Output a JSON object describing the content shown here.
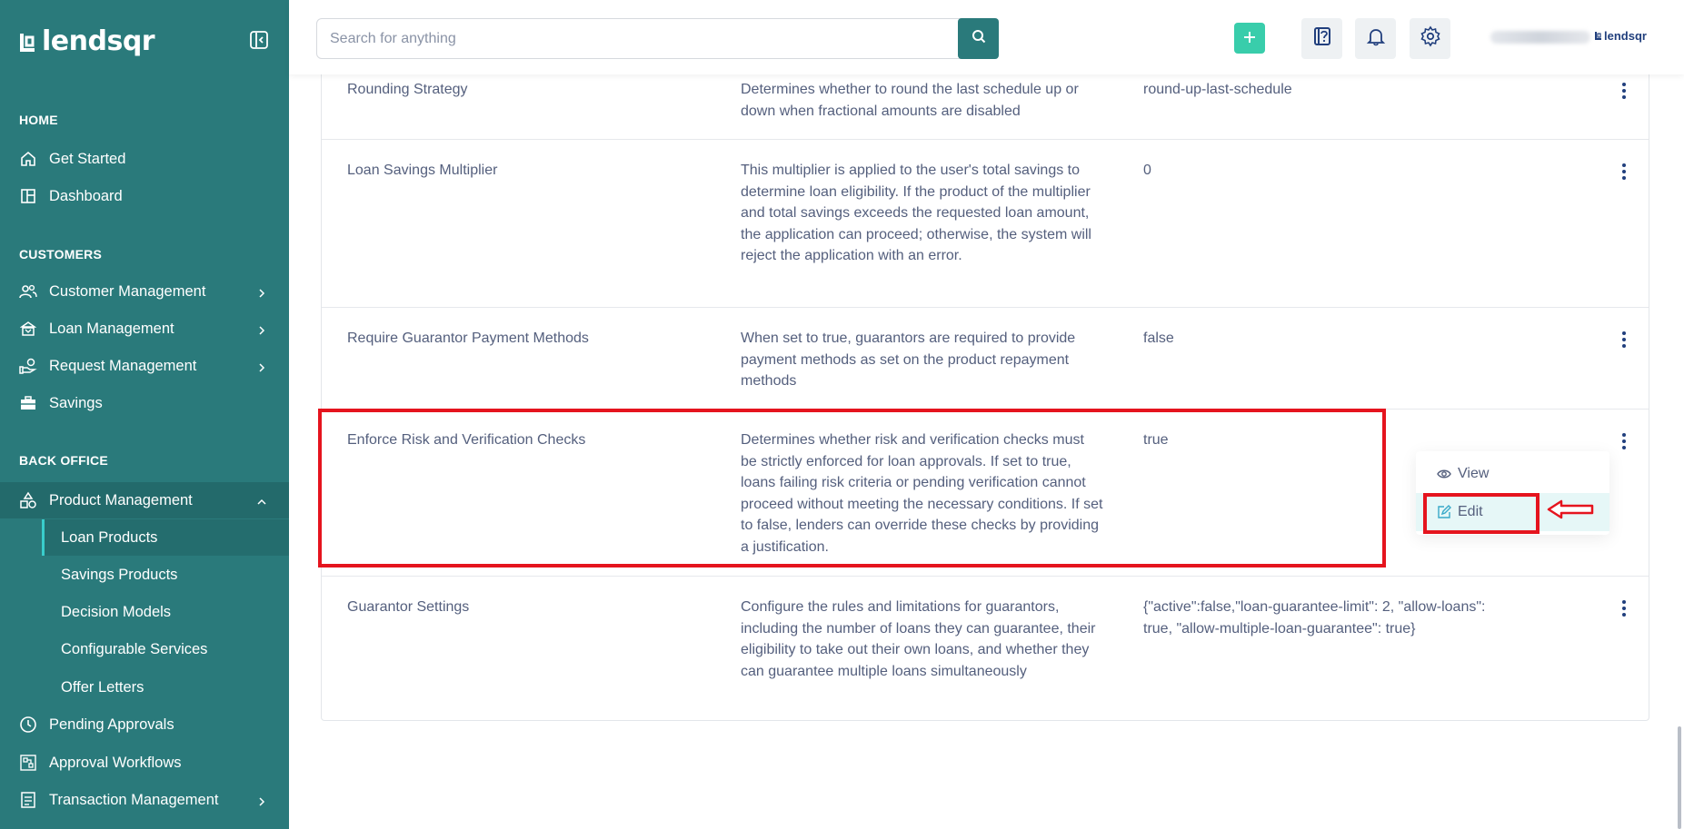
{
  "app": {
    "brand": "lendsqr",
    "brand_small": "lendsqr"
  },
  "colors": {
    "sidebar": "#2a7a7b",
    "accent": "#39cdab",
    "highlight": "#e5141e",
    "text": "#545f7d"
  },
  "topbar": {
    "search_placeholder": "Search for anything"
  },
  "sidebar": {
    "home_label": "HOME",
    "customers_label": "CUSTOMERS",
    "backoffice_label": "BACK OFFICE",
    "items": {
      "get_started": "Get Started",
      "dashboard": "Dashboard",
      "customer_management": "Customer Management",
      "loan_management": "Loan Management",
      "request_management": "Request Management",
      "savings": "Savings",
      "product_management": "Product Management",
      "loan_products": "Loan Products",
      "savings_products": "Savings Products",
      "decision_models": "Decision Models",
      "configurable_services": "Configurable Services",
      "offer_letters": "Offer Letters",
      "pending_approvals": "Pending Approvals",
      "approval_workflows": "Approval Workflows",
      "transaction_management": "Transaction Management"
    }
  },
  "rows": [
    {
      "name": "Rounding Strategy",
      "desc": "Determines whether to round the last schedule up or down when fractional amounts are disabled",
      "value": "round-up-last-schedule"
    },
    {
      "name": "Loan Savings Multiplier",
      "desc": "This multiplier is applied to the user's total savings to determine loan eligibility. If the product of the multiplier and total savings exceeds the requested loan amount, the application can proceed; otherwise, the system will reject the application with an error.",
      "value": "0"
    },
    {
      "name": "Require Guarantor Payment Methods",
      "desc": "When set to true, guarantors are required to provide payment methods as set on the product repayment methods",
      "value": "false"
    },
    {
      "name": "Enforce Risk and Verification Checks",
      "desc": "Determines whether risk and verification checks must be strictly enforced for loan approvals. If set to true, loans failing risk criteria or pending verification cannot proceed without meeting the necessary conditions. If set to false, lenders can override these checks by providing a justification.",
      "value": "true"
    },
    {
      "name": "Guarantor Settings",
      "desc": "Configure the rules and limitations for guarantors, including the number of loans they can guarantee, their eligibility to take out their own loans, and whether they can guarantee multiple loans simultaneously",
      "value": "{\"active\":false,\"loan-guarantee-limit\": 2, \"allow-loans\": true, \"allow-multiple-loan-guarantee\": true}"
    }
  ],
  "menu": {
    "view": "View",
    "edit": "Edit"
  }
}
